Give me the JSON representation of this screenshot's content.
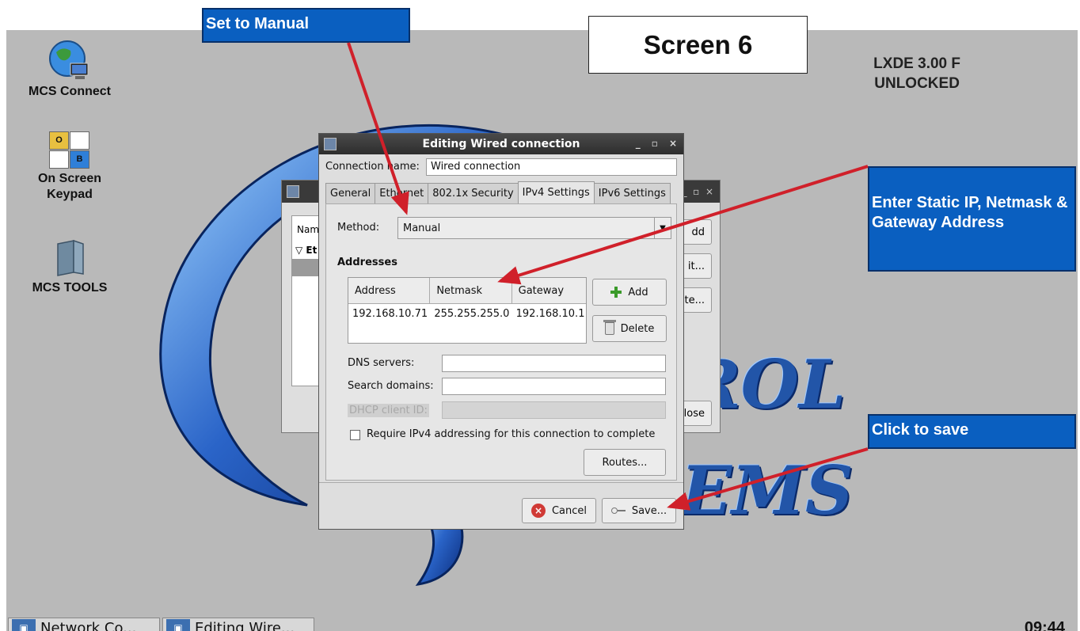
{
  "annotations": {
    "set_manual": "Set to Manual",
    "screen_label": "Screen 6",
    "enter_static": "Enter Static IP, Netmask & Gateway Address",
    "click_save": "Click to save"
  },
  "desktop": {
    "version_line1": "LXDE 3.00 F",
    "version_line2": "UNLOCKED",
    "wallpaper_text1": "ROL",
    "wallpaper_text2": "EMS",
    "icons": [
      {
        "label": "MCS Connect",
        "icon": "globe-computer-icon"
      },
      {
        "label": "On Screen Keypad",
        "icon": "keypad-icon",
        "key1": "O",
        "key2": "B"
      },
      {
        "label": "MCS TOOLS",
        "icon": "folder-icon"
      }
    ],
    "clock": "09:44"
  },
  "taskbar": {
    "items": [
      "Network Co...",
      "Editing Wire..."
    ]
  },
  "back_window": {
    "list_header": "Nam",
    "list_item": "Et",
    "buttons": [
      "dd",
      "it...",
      "ete...",
      "lose"
    ]
  },
  "dialog": {
    "title": "Editing Wired connection",
    "connection_name_label": "Connection name:",
    "connection_name_value": "Wired connection",
    "tabs": [
      "General",
      "Ethernet",
      "802.1x Security",
      "IPv4 Settings",
      "IPv6 Settings"
    ],
    "active_tab": "IPv4 Settings",
    "method_label": "Method:",
    "method_value": "Manual",
    "addresses_heading": "Addresses",
    "columns": [
      "Address",
      "Netmask",
      "Gateway"
    ],
    "rows": [
      [
        "192.168.10.71",
        "255.255.255.0",
        "192.168.10.1"
      ]
    ],
    "add_label": "Add",
    "delete_label": "Delete",
    "dns_label": "DNS servers:",
    "dns_value": "",
    "search_label": "Search domains:",
    "search_value": "",
    "dhcp_label": "DHCP client ID:",
    "dhcp_value": "",
    "require_label": "Require IPv4 addressing for this connection to complete",
    "require_checked": false,
    "routes_label": "Routes...",
    "cancel_label": "Cancel",
    "save_label": "Save..."
  },
  "colors": {
    "desktop_bg": "#b9b9b9",
    "callout_bg": "#0a5fc0",
    "arrow": "#d0202a",
    "titlebar": "#2d2d2d"
  }
}
